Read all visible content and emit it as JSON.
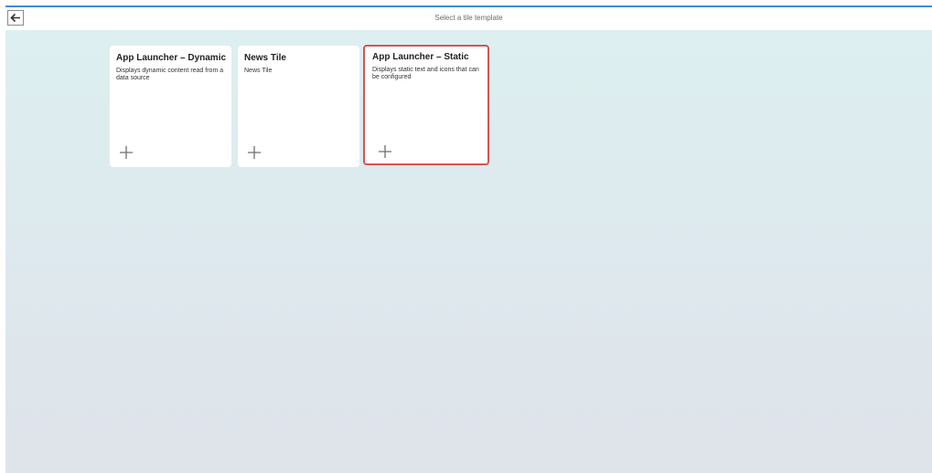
{
  "header": {
    "title": "Select a tile template",
    "back_icon": "arrow-left-icon"
  },
  "tiles": [
    {
      "title": "App Launcher – Dynamic",
      "description": "Displays dynamic content read from a data source",
      "add_icon": "plus-icon",
      "selected": false
    },
    {
      "title": "News Tile",
      "description": "News Tile",
      "add_icon": "plus-icon",
      "selected": false
    },
    {
      "title": "App Launcher – Static",
      "description": "Displays static text and icons that can be configured",
      "add_icon": "plus-icon",
      "selected": true
    }
  ],
  "colors": {
    "accent_bar": "#3a8fd6",
    "selected_border": "#d9534f",
    "background_top": "#ddf0f0",
    "background_bottom": "#dfe3ea"
  }
}
